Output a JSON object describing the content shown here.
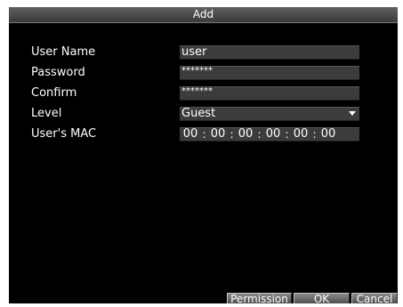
{
  "dialog": {
    "title": "Add"
  },
  "form": {
    "user_name": {
      "label": "User Name",
      "value": "user"
    },
    "password": {
      "label": "Password",
      "value": "*******"
    },
    "confirm": {
      "label": "Confirm",
      "value": "*******"
    },
    "level": {
      "label": "Level",
      "value": "Guest",
      "icon": "dropdown-arrow-icon"
    },
    "mac": {
      "label": "User's MAC",
      "octets": [
        "00",
        "00",
        "00",
        "00",
        "00",
        "00"
      ],
      "separator": ":"
    }
  },
  "buttons": {
    "permission": "Permission",
    "ok": "OK",
    "cancel": "Cancel"
  },
  "colors": {
    "background": "#000000",
    "field": "#3c3c3c",
    "text": "#ffffff",
    "titlebar": "#4a4a4a"
  }
}
